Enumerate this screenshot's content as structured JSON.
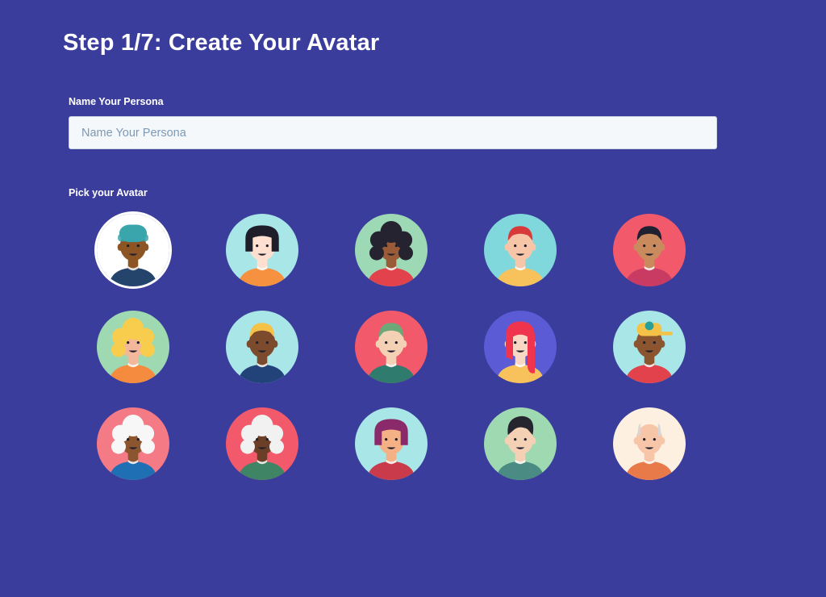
{
  "page": {
    "title": "Step 1/7: Create Your Avatar"
  },
  "persona_name": {
    "label": "Name Your Persona",
    "placeholder": "Name Your Persona",
    "value": ""
  },
  "avatar_picker": {
    "label": "Pick your Avatar",
    "selected_index": 0,
    "avatars": [
      {
        "name": "avatar-teal-beanie-man-icon",
        "bg": "#ffffff",
        "skin": "#8d5524",
        "hair": "#3aa5ab",
        "hair_style": "beanie",
        "shirt": "#24446b"
      },
      {
        "name": "avatar-black-bob-buns-woman-icon",
        "bg": "#a8e6e8",
        "skin": "#ffe0d0",
        "hair": "#1e1e2a",
        "hair_style": "bob",
        "shirt": "#f6913f"
      },
      {
        "name": "avatar-black-curly-hair-woman-icon",
        "bg": "#9dd9b5",
        "skin": "#9a5c38",
        "hair": "#25232f",
        "hair_style": "curly",
        "shirt": "#e2424b"
      },
      {
        "name": "avatar-red-hair-freckles-man-icon",
        "bg": "#81d8dc",
        "skin": "#f7c6a9",
        "hair": "#d83a3a",
        "hair_style": "short",
        "shirt": "#f7c15c"
      },
      {
        "name": "avatar-dark-hair-man-icon",
        "bg": "#f25a6b",
        "skin": "#c98b5e",
        "hair": "#1f2030",
        "hair_style": "short",
        "shirt": "#c93b63"
      },
      {
        "name": "avatar-blonde-curly-woman-icon",
        "bg": "#9ed9b2",
        "skin": "#f3b79c",
        "hair": "#f8cd4e",
        "hair_style": "curly",
        "shirt": "#f58b3e"
      },
      {
        "name": "avatar-blonde-crew-cut-man-icon",
        "bg": "#a8e6e8",
        "skin": "#7c4a2d",
        "hair": "#f4c247",
        "hair_style": "short",
        "shirt": "#21437a"
      },
      {
        "name": "avatar-green-hair-mustache-man-icon",
        "bg": "#f25a6b",
        "skin": "#f4d1b5",
        "hair": "#6da879",
        "hair_style": "short",
        "shirt": "#2f7b6d"
      },
      {
        "name": "avatar-red-ponytail-woman-icon",
        "bg": "#5b5bd6",
        "skin": "#f8d7c5",
        "hair": "#f0344d",
        "hair_style": "long",
        "shirt": "#f7c15c"
      },
      {
        "name": "avatar-yellow-cap-glasses-man-icon",
        "bg": "#a8e6e8",
        "skin": "#8b5530",
        "hair": "#f4c247",
        "hair_style": "cap",
        "shirt": "#e2424b"
      },
      {
        "name": "avatar-white-afro-woman-icon",
        "bg": "#f47a86",
        "skin": "#8b5530",
        "hair": "#f7f7f7",
        "hair_style": "curly",
        "shirt": "#1f6fb4"
      },
      {
        "name": "avatar-white-hair-beard-man-icon",
        "bg": "#f25a6b",
        "skin": "#6b3f27",
        "hair": "#f1f1f1",
        "hair_style": "curly",
        "shirt": "#3f8565"
      },
      {
        "name": "avatar-purple-hair-glasses-woman-icon",
        "bg": "#a8e6e8",
        "skin": "#f4b185",
        "hair": "#8b2a6b",
        "hair_style": "bob",
        "shirt": "#c93b4b"
      },
      {
        "name": "avatar-pompadour-beard-man-icon",
        "bg": "#9ed9b2",
        "skin": "#f4d1b5",
        "hair": "#24252f",
        "hair_style": "pompadour",
        "shirt": "#4a8b83"
      },
      {
        "name": "avatar-bald-grey-man-icon",
        "bg": "#fdf0e1",
        "skin": "#f7c6a9",
        "hair": "#d7d7d7",
        "hair_style": "bald",
        "shirt": "#e87a4a"
      }
    ]
  }
}
